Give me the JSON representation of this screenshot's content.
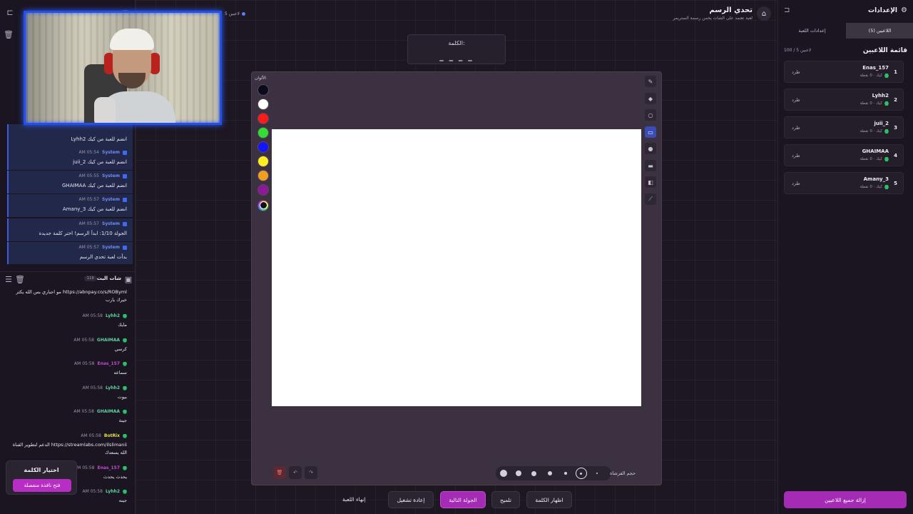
{
  "left": {
    "system_messages": [
      {
        "name": "",
        "time": "",
        "text": "Lyhh2 انضم للعبة من كيك"
      },
      {
        "name": "System",
        "time": "AM 05:54",
        "text": "juii_2 انضم للعبة من كيك"
      },
      {
        "name": "System",
        "time": "AM 05:55",
        "text": "GHAIMAA انضم للعبة من كيك"
      },
      {
        "name": "System",
        "time": "AM 05:57",
        "text": "Amany_3 انضم للعبة من كيك"
      },
      {
        "name": "System",
        "time": "AM 05:57",
        "text": "الجولة 1/10: ابدأ الرسم! اختر كلمة جديدة"
      },
      {
        "name": "System",
        "time": "AM 05:57",
        "text": "بدأت لعبة تحدي الرسم"
      }
    ],
    "chat_title": "شات البث",
    "chat_count": "119",
    "chat_messages": [
      {
        "user": "",
        "color": "#b16ff0",
        "time": "",
        "text": "مو اجباري بس الله يكثر https://abnpay.co/s/ROByml خيرك يارب"
      },
      {
        "user": "Lyhh2",
        "color": "#5fd3a0",
        "time": "AM 05:58",
        "text": "مايك"
      },
      {
        "user": "GHAIMAA",
        "color": "#5fd3a0",
        "time": "AM 05:58",
        "text": "كرسي"
      },
      {
        "user": "Enas_157",
        "color": "#c24bd0",
        "time": "AM 05:58",
        "text": "سماعه"
      },
      {
        "user": "Lyhh2",
        "color": "#5fd3a0",
        "time": "AM 05:58",
        "text": "بيوت"
      },
      {
        "user": "GHAIMAA",
        "color": "#5fd3a0",
        "time": "AM 05:58",
        "text": "جينة"
      },
      {
        "user": "BotRix",
        "color": "#e6e050",
        "time": "AM 05:58",
        "text": "الدعم لتطوير القناة https://streamlabs.com/ilslimanii الله يسعدك"
      },
      {
        "user": "Enas_157",
        "color": "#c24bd0",
        "time": "AM 05:58",
        "text": "يحدث يحدث"
      },
      {
        "user": "Lyhh2",
        "color": "#5fd3a0",
        "time": "AM 05:58",
        "text": "جينه"
      }
    ],
    "word_pick": {
      "title": "اختيار الكلمة",
      "button": "فتح نافذة منفصلة"
    }
  },
  "header": {
    "title": "تحدي الرسم",
    "subtitle": "لعبة تعتمد على الشات يخمن رسمة الستريمر",
    "players_count": "5 لاعبين"
  },
  "word": {
    "label": "الكلمة:",
    "blanks": "_ _ _ _"
  },
  "canvas": {
    "colors_label": "الألوان",
    "colors": [
      "#0b0b1a",
      "#ffffff",
      "#ff1a1a",
      "#33dd33",
      "#1414ff",
      "#ffee22",
      "#f0a020",
      "#8a1a9a"
    ],
    "brush_label": "حجم الفرشاة"
  },
  "actions": {
    "end_game": "إنهاء اللعبة",
    "restart": "إعادة تشغيل",
    "next_round": "الجولة التالية",
    "hint": "تلميح",
    "reveal": "اظهار الكلمة"
  },
  "right": {
    "title": "الإعدادات",
    "tab_players": "اللاعبين (5)",
    "tab_settings": "إعدادات اللعبة",
    "list_title": "قائمة اللاعبين",
    "list_count": "100 / 5 لاعبين",
    "players": [
      {
        "rank": "1",
        "name": "Enas_157",
        "sub": "كيك · 0 نقطة"
      },
      {
        "rank": "2",
        "name": "Lyhh2",
        "sub": "كيك · 0 نقطة"
      },
      {
        "rank": "3",
        "name": "juii_2",
        "sub": "كيك · 0 نقطة"
      },
      {
        "rank": "4",
        "name": "GHAIMAA",
        "sub": "كيك · 0 نقطة"
      },
      {
        "rank": "5",
        "name": "Amany_3",
        "sub": "كيك · 0 نقطة"
      }
    ],
    "kick_label": "طرد",
    "remove_all": "إزالة جميع اللاعبين"
  }
}
